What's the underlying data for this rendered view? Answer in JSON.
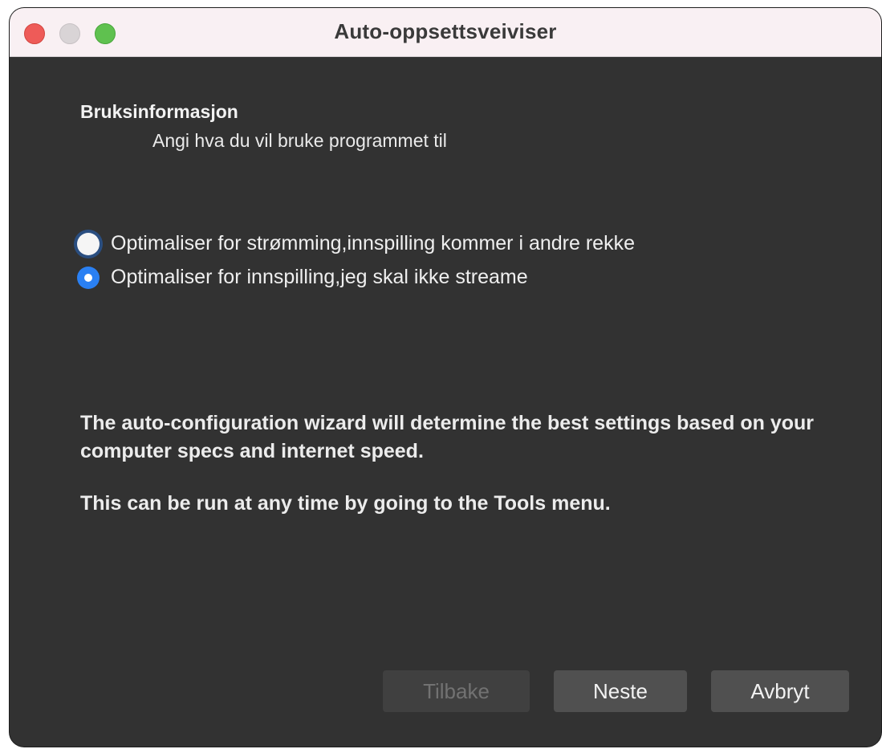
{
  "window": {
    "title": "Auto-oppsettsveiviser"
  },
  "usage": {
    "heading": "Bruksinformasjon",
    "subheading": "Angi hva du vil bruke programmet til"
  },
  "options": [
    {
      "label": "Optimaliser for strømming,innspilling kommer i andre rekke",
      "selected": false
    },
    {
      "label": "Optimaliser for innspilling,jeg skal ikke streame",
      "selected": true
    }
  ],
  "info": {
    "line1": "The auto-configuration wizard will determine the best settings based on your computer specs and internet speed.",
    "line2": "This can be run at any time by going to the Tools menu."
  },
  "buttons": {
    "back": "Tilbake",
    "next": "Neste",
    "cancel": "Avbryt"
  },
  "colors": {
    "background": "#323232",
    "titlebar": "#f9f0f3",
    "accent": "#2a80f3",
    "close": "#ee5b58",
    "maximize": "#5fc14f"
  }
}
